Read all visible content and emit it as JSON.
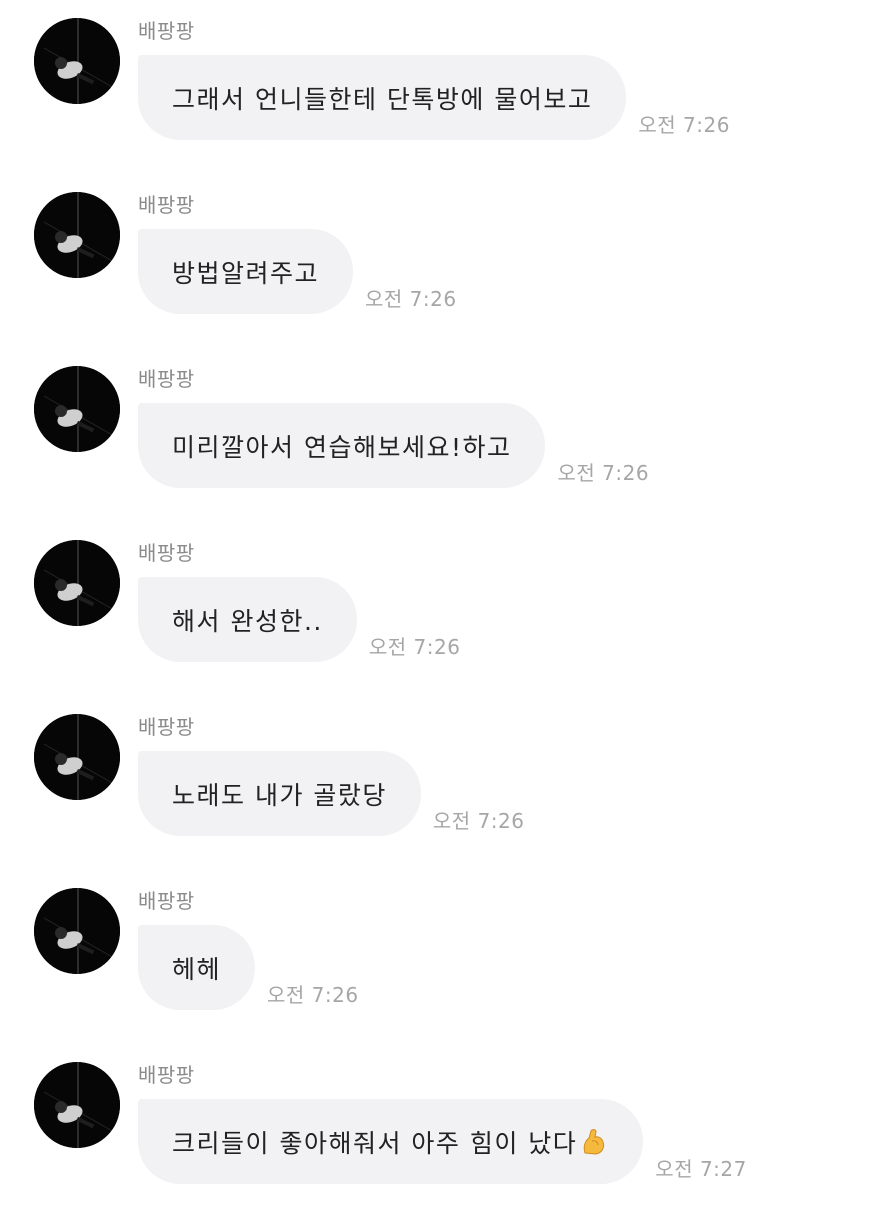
{
  "messages": [
    {
      "sender": "배팡팡",
      "text": "그래서 언니들한테 단톡방에 물어보고",
      "time": "오전 7:26"
    },
    {
      "sender": "배팡팡",
      "text": "방법알려주고",
      "time": "오전 7:26"
    },
    {
      "sender": "배팡팡",
      "text": "미리깔아서 연습해보세요!하고",
      "time": "오전 7:26"
    },
    {
      "sender": "배팡팡",
      "text": "해서 완성한..",
      "time": "오전 7:26"
    },
    {
      "sender": "배팡팡",
      "text": "노래도 내가 골랐당",
      "time": "오전 7:26"
    },
    {
      "sender": "배팡팡",
      "text": "헤헤",
      "time": "오전 7:26"
    },
    {
      "sender": "배팡팡",
      "text": "크리들이 좋아해줘서 아주 힘이 났다",
      "emoji": "flexed-biceps-icon",
      "time": "오전 7:27"
    }
  ],
  "colors": {
    "bubble": "#f2f2f4",
    "sender": "#8b8b8b",
    "time": "#a6a6a6",
    "text": "#222222"
  }
}
